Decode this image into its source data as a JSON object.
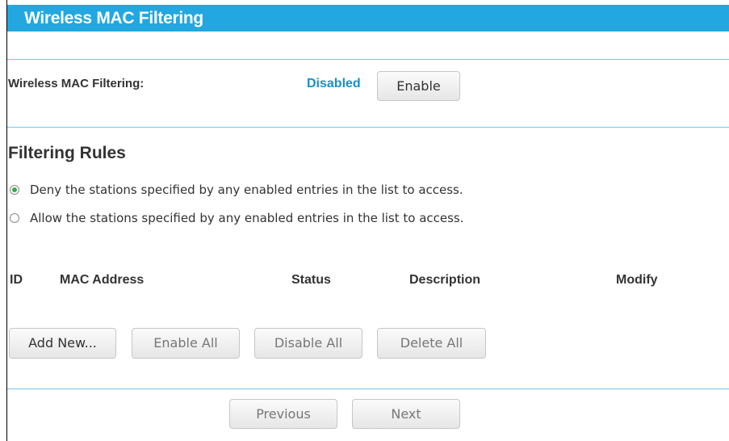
{
  "header": {
    "title": "Wireless MAC Filtering"
  },
  "mac_filtering": {
    "label": "Wireless MAC Filtering:",
    "status": "Disabled",
    "enable_button": "Enable"
  },
  "filtering_rules": {
    "title": "Filtering Rules",
    "options": [
      {
        "label": "Deny the stations specified by any enabled entries in the list to access.",
        "selected": true
      },
      {
        "label": "Allow the stations specified by any enabled entries in the list to access.",
        "selected": false
      }
    ]
  },
  "table": {
    "columns": [
      "ID",
      "MAC Address",
      "Status",
      "Description",
      "Modify"
    ]
  },
  "actions": {
    "add_new": "Add New...",
    "enable_all": "Enable All",
    "disable_all": "Disable All",
    "delete_all": "Delete All"
  },
  "navigation": {
    "previous": "Previous",
    "next": "Next"
  },
  "colors": {
    "title_bar": "#22a7e0",
    "status_text": "#1a8fc7",
    "divider": "#6ec9ec",
    "radio_selected": "#3aa84a"
  }
}
